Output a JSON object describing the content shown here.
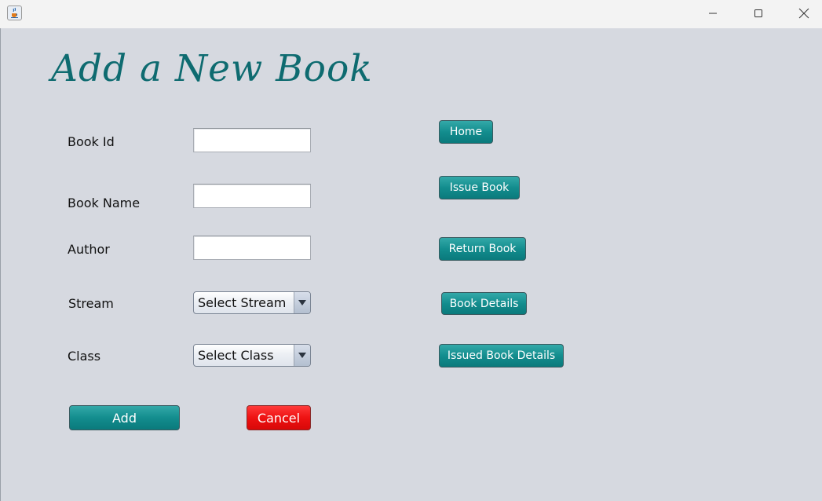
{
  "window": {
    "app_icon": "java-coffee-cup-icon"
  },
  "form": {
    "heading": "Add a New Book",
    "labels": {
      "book_id": "Book Id",
      "book_name": "Book Name",
      "author": "Author",
      "stream": "Stream",
      "class": "Class"
    },
    "fields": {
      "book_id": "",
      "book_name": "",
      "author": ""
    },
    "stream_select": "Select Stream",
    "class_select": "Select Class",
    "add_label": "Add",
    "cancel_label": "Cancel"
  },
  "nav": {
    "home": "Home",
    "issue_book": "Issue Book",
    "return_book": "Return Book",
    "book_details": "Book Details",
    "issued_book_details": "Issued Book Details"
  },
  "colors": {
    "accent": "#138d8e",
    "heading": "#0e6b70",
    "cancel": "#ee1212",
    "background": "#d6d9e0"
  }
}
